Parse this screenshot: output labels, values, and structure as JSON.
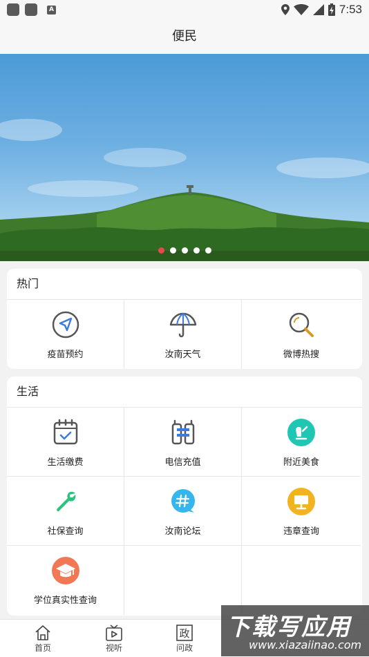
{
  "status_bar": {
    "time": "7:53",
    "icons": [
      "notification-icon",
      "notification-icon",
      "text-icon",
      "location-icon",
      "wifi-icon",
      "signal-icon",
      "battery-icon"
    ]
  },
  "header": {
    "title": "便民"
  },
  "banner": {
    "dots": 5,
    "active_dot": 1,
    "active_color": "#e8474c"
  },
  "sections": [
    {
      "title": "热门",
      "items": [
        {
          "label": "疫苗预约",
          "icon": "navigation-arrow-icon"
        },
        {
          "label": "汝南天气",
          "icon": "umbrella-icon"
        },
        {
          "label": "微博热搜",
          "icon": "magnifier-icon"
        }
      ]
    },
    {
      "title": "生活",
      "items": [
        {
          "label": "生活缴费",
          "icon": "calendar-check-icon"
        },
        {
          "label": "电信充值",
          "icon": "phone-recharge-icon"
        },
        {
          "label": "附近美食",
          "icon": "food-icon"
        },
        {
          "label": "社保查询",
          "icon": "wrench-icon"
        },
        {
          "label": "汝南论坛",
          "icon": "forum-hashtag-icon"
        },
        {
          "label": "违章查询",
          "icon": "monitor-icon"
        },
        {
          "label": "学位真实性查询",
          "icon": "graduation-cap-icon"
        }
      ]
    }
  ],
  "bottom_nav": [
    {
      "label": "首页",
      "icon": "home-icon"
    },
    {
      "label": "视听",
      "icon": "tv-play-icon"
    },
    {
      "label": "问政",
      "icon": "zheng-icon"
    }
  ],
  "watermark": {
    "big": "下载写应用",
    "small": "www.xiazaiinao.com"
  },
  "colors": {
    "accent_red": "#e8474c",
    "icon_blue": "#3d7be0",
    "icon_teal": "#1fc6b4",
    "icon_green": "#2ec27e",
    "icon_yellow": "#f2b320",
    "icon_orange": "#f07855",
    "icon_gold": "#d99a1e"
  }
}
